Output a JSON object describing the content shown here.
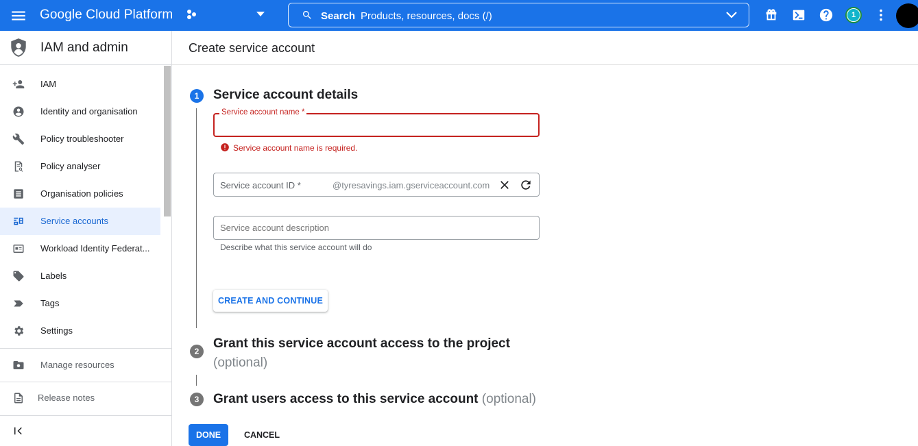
{
  "topbar": {
    "brand": "Google Cloud Platform",
    "search_label": "Search",
    "search_placeholder": "Products, resources, docs (/)",
    "notification_count": "1"
  },
  "sidebar": {
    "title": "IAM and admin",
    "items": [
      {
        "label": "IAM",
        "icon": "person-add-icon"
      },
      {
        "label": "Identity and organisation",
        "icon": "account-circle-icon"
      },
      {
        "label": "Policy troubleshooter",
        "icon": "wrench-icon"
      },
      {
        "label": "Policy analyser",
        "icon": "document-search-icon"
      },
      {
        "label": "Organisation policies",
        "icon": "list-icon"
      },
      {
        "label": "Service accounts",
        "icon": "service-account-icon",
        "active": true
      },
      {
        "label": "Workload Identity Federat...",
        "icon": "id-card-icon"
      },
      {
        "label": "Labels",
        "icon": "label-icon"
      },
      {
        "label": "Tags",
        "icon": "tag-icon"
      },
      {
        "label": "Settings",
        "icon": "gear-icon"
      }
    ],
    "manage_resources": "Manage resources",
    "release_notes": "Release notes"
  },
  "page": {
    "title": "Create service account"
  },
  "steps": [
    {
      "number": "1",
      "title": "Service account details",
      "optional": ""
    },
    {
      "number": "2",
      "title": "Grant this service account access to the project",
      "optional": "(optional)"
    },
    {
      "number": "3",
      "title": "Grant users access to this service account",
      "optional": "(optional)"
    }
  ],
  "form": {
    "name_label": "Service account name *",
    "name_value": "",
    "name_error": "Service account name is required.",
    "id_label": "Service account ID *",
    "id_suffix": "@tyresavings.iam.gserviceaccount.com",
    "description_placeholder": "Service account description",
    "description_helper": "Describe what this service account will do",
    "create_button": "CREATE AND CONTINUE"
  },
  "actions": {
    "done": "DONE",
    "cancel": "CANCEL"
  },
  "colors": {
    "primary": "#1a73e8",
    "error": "#c5221f",
    "active_bg": "#e8f0fe"
  }
}
